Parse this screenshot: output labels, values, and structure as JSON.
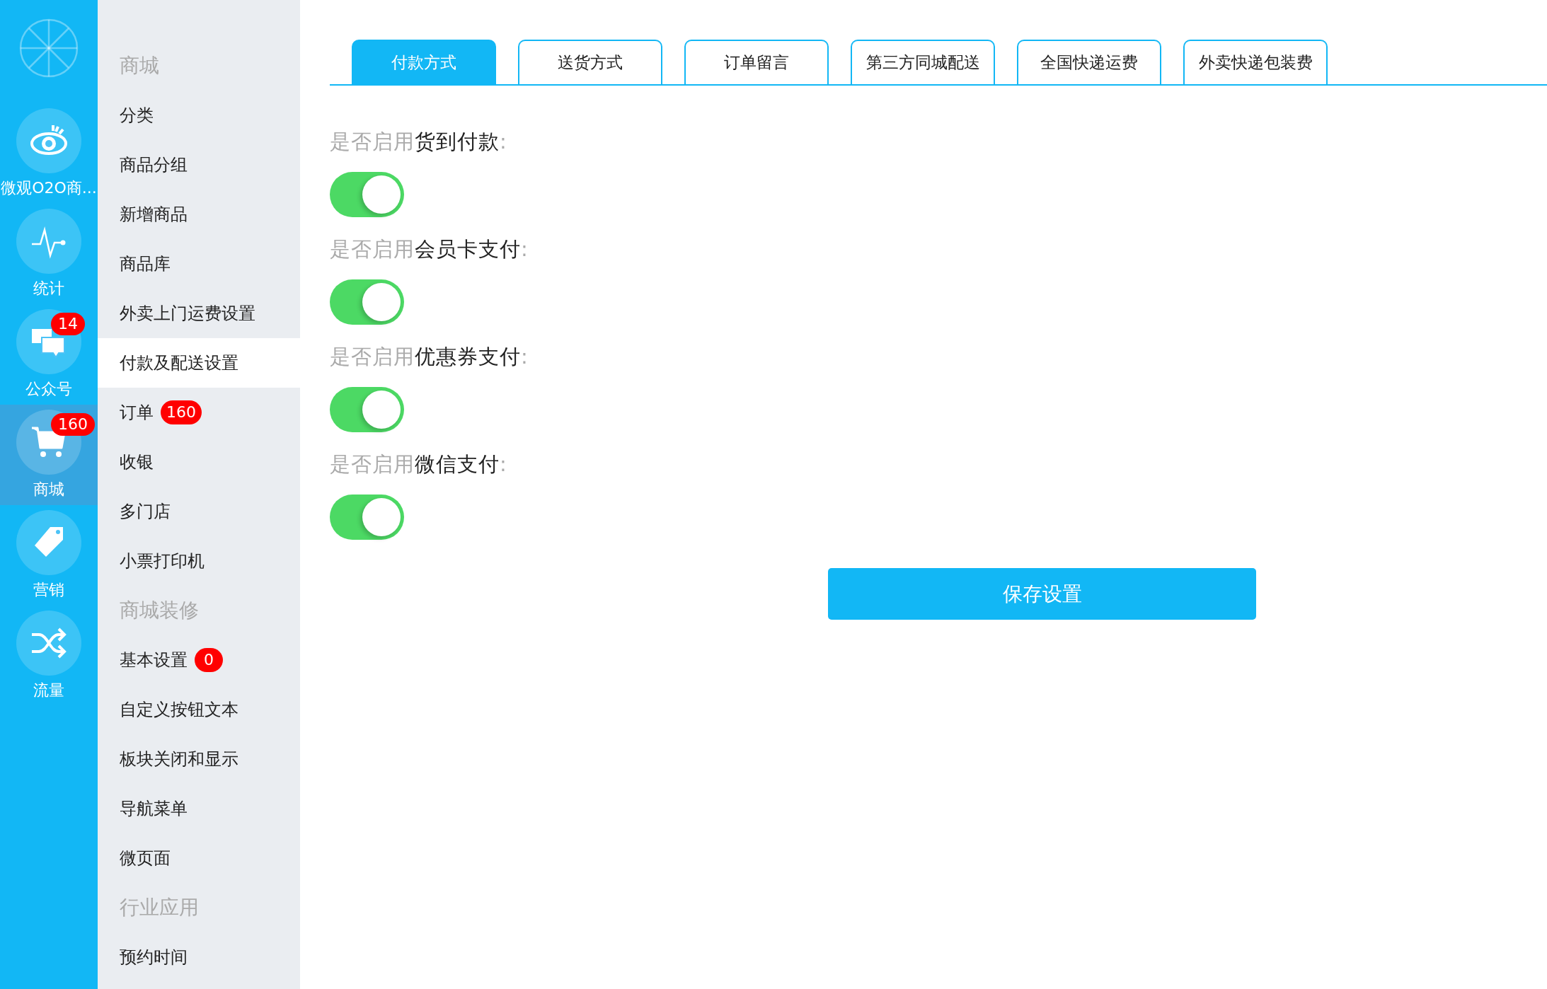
{
  "rail": {
    "items": [
      {
        "label": "微观O2O商...",
        "selected": false
      },
      {
        "label": "统计",
        "selected": false
      },
      {
        "label": "公众号",
        "badge": "14",
        "selected": false
      },
      {
        "label": "商城",
        "badge": "160",
        "selected": true
      },
      {
        "label": "营销",
        "selected": false
      },
      {
        "label": "流量",
        "selected": false
      }
    ]
  },
  "sidebar": {
    "items": [
      {
        "kind": "heading",
        "label": "商城"
      },
      {
        "kind": "link",
        "label": "分类",
        "selected": false
      },
      {
        "kind": "link",
        "label": "商品分组",
        "selected": false
      },
      {
        "kind": "link",
        "label": "新增商品",
        "selected": false
      },
      {
        "kind": "link",
        "label": "商品库",
        "selected": false
      },
      {
        "kind": "link",
        "label": "外卖上门运费设置",
        "selected": false
      },
      {
        "kind": "link",
        "label": "付款及配送设置",
        "selected": true
      },
      {
        "kind": "link",
        "label": "订单",
        "badge": "160",
        "selected": false
      },
      {
        "kind": "link",
        "label": "收银",
        "selected": false
      },
      {
        "kind": "link",
        "label": "多门店",
        "selected": false
      },
      {
        "kind": "link",
        "label": "小票打印机",
        "selected": false
      },
      {
        "kind": "heading",
        "label": "商城装修"
      },
      {
        "kind": "link",
        "label": "基本设置",
        "badge": "0",
        "selected": false
      },
      {
        "kind": "link",
        "label": "自定义按钮文本",
        "selected": false
      },
      {
        "kind": "link",
        "label": "板块关闭和显示",
        "selected": false
      },
      {
        "kind": "link",
        "label": "导航菜单",
        "selected": false
      },
      {
        "kind": "link",
        "label": "微页面",
        "selected": false
      },
      {
        "kind": "heading",
        "label": "行业应用"
      },
      {
        "kind": "link",
        "label": "预约时间",
        "selected": false
      }
    ]
  },
  "tabs": [
    {
      "label": "付款方式",
      "selected": true
    },
    {
      "label": "送货方式",
      "selected": false
    },
    {
      "label": "订单留言",
      "selected": false
    },
    {
      "label": "第三方同城配送",
      "selected": false
    },
    {
      "label": "全国快递运费",
      "selected": false
    },
    {
      "label": "外卖快递包装费",
      "selected": false
    }
  ],
  "settings": [
    {
      "prefix": "是否启用",
      "subject": "货到付款",
      "colon": ":",
      "on": true
    },
    {
      "prefix": "是否启用",
      "subject": "会员卡支付",
      "colon": ":",
      "on": true
    },
    {
      "prefix": "是否启用",
      "subject": "优惠券支付",
      "colon": ":",
      "on": true
    },
    {
      "prefix": "是否启用",
      "subject": "微信支付",
      "colon": ":",
      "on": true
    }
  ],
  "save_button": "保存设置"
}
